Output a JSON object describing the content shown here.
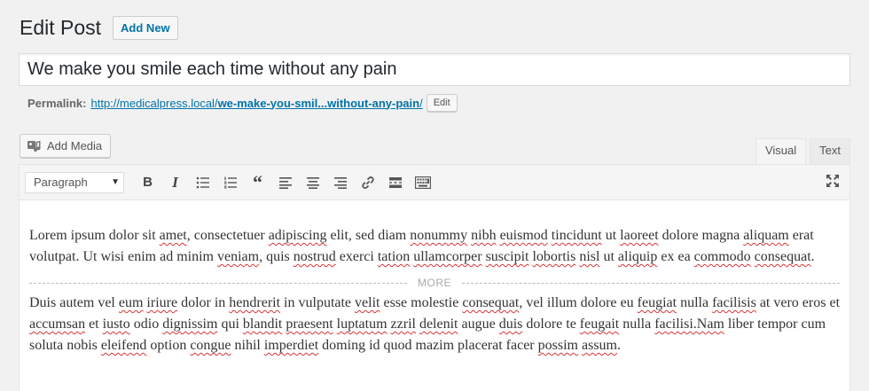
{
  "header": {
    "title": "Edit Post",
    "add_new_label": "Add New"
  },
  "post": {
    "title": "We make you smile each time without any pain"
  },
  "permalink": {
    "label": "Permalink:",
    "url_base": "http://medicalpress.local/",
    "slug": "we-make-you-smil...without-any-pain",
    "url_suffix": "/",
    "edit_label": "Edit"
  },
  "media": {
    "add_media_label": "Add Media"
  },
  "editor_tabs": {
    "visual": "Visual",
    "text": "Text",
    "active": "Visual"
  },
  "toolbar": {
    "format_value": "Paragraph",
    "buttons": [
      "bold-icon",
      "italic-icon",
      "bulleted-list-icon",
      "numbered-list-icon",
      "blockquote-icon",
      "align-left-icon",
      "align-center-icon",
      "align-right-icon",
      "link-icon",
      "read-more-icon",
      "toolbar-toggle-icon"
    ],
    "fullscreen": "fullscreen-icon"
  },
  "content": {
    "more_label": "MORE",
    "p1": [
      {
        "t": "Lorem ipsum dolor sit "
      },
      {
        "t": "amet",
        "s": 1
      },
      {
        "t": ", consectetuer "
      },
      {
        "t": "adipiscing",
        "s": 1
      },
      {
        "t": " elit, sed diam "
      },
      {
        "t": "nonummy",
        "s": 1
      },
      {
        "t": " "
      },
      {
        "t": "nibh",
        "s": 1
      },
      {
        "t": " "
      },
      {
        "t": "euismod",
        "s": 1
      },
      {
        "t": " "
      },
      {
        "t": "tincidunt",
        "s": 1
      },
      {
        "t": " ut "
      },
      {
        "t": "laoreet",
        "s": 1
      },
      {
        "t": " dolore magna "
      },
      {
        "t": "aliquam",
        "s": 1
      },
      {
        "t": " erat volutpat. Ut wisi enim ad minim "
      },
      {
        "t": "veniam",
        "s": 1
      },
      {
        "t": ", quis "
      },
      {
        "t": "nostrud",
        "s": 1
      },
      {
        "t": " exerci "
      },
      {
        "t": "tation",
        "s": 1
      },
      {
        "t": " "
      },
      {
        "t": "ullamcorper",
        "s": 1
      },
      {
        "t": " "
      },
      {
        "t": "suscipit",
        "s": 1
      },
      {
        "t": " "
      },
      {
        "t": "lobortis",
        "s": 1
      },
      {
        "t": " "
      },
      {
        "t": "nisl",
        "s": 1
      },
      {
        "t": " ut "
      },
      {
        "t": "aliquip",
        "s": 1
      },
      {
        "t": " ex ea "
      },
      {
        "t": "commodo",
        "s": 1
      },
      {
        "t": " "
      },
      {
        "t": "consequat",
        "s": 1
      },
      {
        "t": "."
      }
    ],
    "p2": [
      {
        "t": "Duis autem vel "
      },
      {
        "t": "eum",
        "s": 1
      },
      {
        "t": " "
      },
      {
        "t": "iriure",
        "s": 1
      },
      {
        "t": " dolor in "
      },
      {
        "t": "hendrerit",
        "s": 1
      },
      {
        "t": " in vulputate "
      },
      {
        "t": "velit",
        "s": 1
      },
      {
        "t": " esse molestie "
      },
      {
        "t": "consequat",
        "s": 1
      },
      {
        "t": ", vel illum dolore eu "
      },
      {
        "t": "feugiat",
        "s": 1
      },
      {
        "t": " nulla "
      },
      {
        "t": "facilisis",
        "s": 1
      },
      {
        "t": " at vero eros et "
      },
      {
        "t": "accumsan",
        "s": 1
      },
      {
        "t": " et "
      },
      {
        "t": "iusto",
        "s": 1
      },
      {
        "t": " odio "
      },
      {
        "t": "dignissim",
        "s": 1
      },
      {
        "t": " qui "
      },
      {
        "t": "blandit",
        "s": 1
      },
      {
        "t": " "
      },
      {
        "t": "praesent",
        "s": 1
      },
      {
        "t": " "
      },
      {
        "t": "luptatum",
        "s": 1
      },
      {
        "t": " "
      },
      {
        "t": "zzril",
        "s": 1
      },
      {
        "t": " "
      },
      {
        "t": "delenit",
        "s": 1
      },
      {
        "t": " augue "
      },
      {
        "t": "duis",
        "s": 1
      },
      {
        "t": " dolore te "
      },
      {
        "t": "feugait",
        "s": 1
      },
      {
        "t": " nulla "
      },
      {
        "t": "facilisi.Nam",
        "s": 1
      },
      {
        "t": " liber tempor cum soluta nobis "
      },
      {
        "t": "eleifend",
        "s": 1
      },
      {
        "t": " option "
      },
      {
        "t": "congue",
        "s": 1
      },
      {
        "t": " nihil "
      },
      {
        "t": "imperdiet",
        "s": 1
      },
      {
        "t": " doming id quod mazim placerat facer "
      },
      {
        "t": "possim",
        "s": 1
      },
      {
        "t": " "
      },
      {
        "t": "assum",
        "s": 1
      },
      {
        "t": "."
      }
    ]
  },
  "colors": {
    "link": "#0073aa",
    "spellcheck": "#d63638",
    "background": "#f1f1f1"
  }
}
